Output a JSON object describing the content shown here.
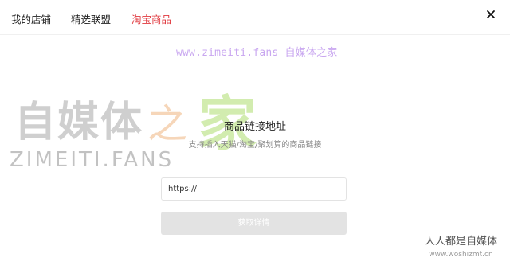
{
  "tabs": [
    {
      "label": "我的店铺"
    },
    {
      "label": "精选联盟"
    },
    {
      "label": "淘宝商品"
    }
  ],
  "active_tab_color": "#e0383e",
  "close_icon": "close-icon",
  "watermark": {
    "url_text": "www.zimeiti.fans",
    "url_cn": "自媒体之家",
    "big_text": "自媒体",
    "zhi": "之",
    "jia": "家",
    "fans_text": "ZIMEITI.FANS",
    "corner_line1": "人人都是自媒体",
    "corner_line2": "www.woshizmt.cn"
  },
  "main": {
    "title": "商品链接地址",
    "subtitle": "支持插入天猫/淘宝/聚划算的商品链接",
    "input_value": "https://",
    "button_label": "获取详情"
  }
}
